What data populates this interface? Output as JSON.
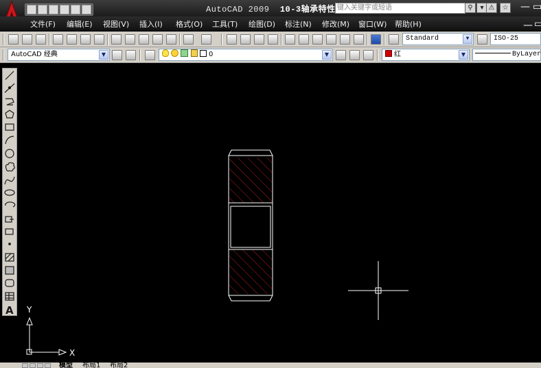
{
  "titlebar": {
    "app_name": "AutoCAD 2009",
    "doc_title": "10-3轴承特性",
    "search_placeholder": "键入关键字或短语"
  },
  "menu": [
    "文件(F)",
    "编辑(E)",
    "视图(V)",
    "插入(I)",
    "格式(O)",
    "工具(T)",
    "绘图(D)",
    "标注(N)",
    "修改(M)",
    "窗口(W)",
    "帮助(H)"
  ],
  "toolbar": {
    "text_style": "Standard",
    "dim_style": "ISO-25",
    "workspace": "AutoCAD 经典",
    "layer": "0",
    "color": "红",
    "linetype": "ByLayer"
  },
  "ucs": {
    "y_label": "Y",
    "x_label": "X"
  },
  "tabs": [
    "模型",
    "布局1",
    "布局2"
  ],
  "colors": {
    "hatch": "#cc2020",
    "outline": "#ffffff",
    "canvas": "#000000"
  }
}
